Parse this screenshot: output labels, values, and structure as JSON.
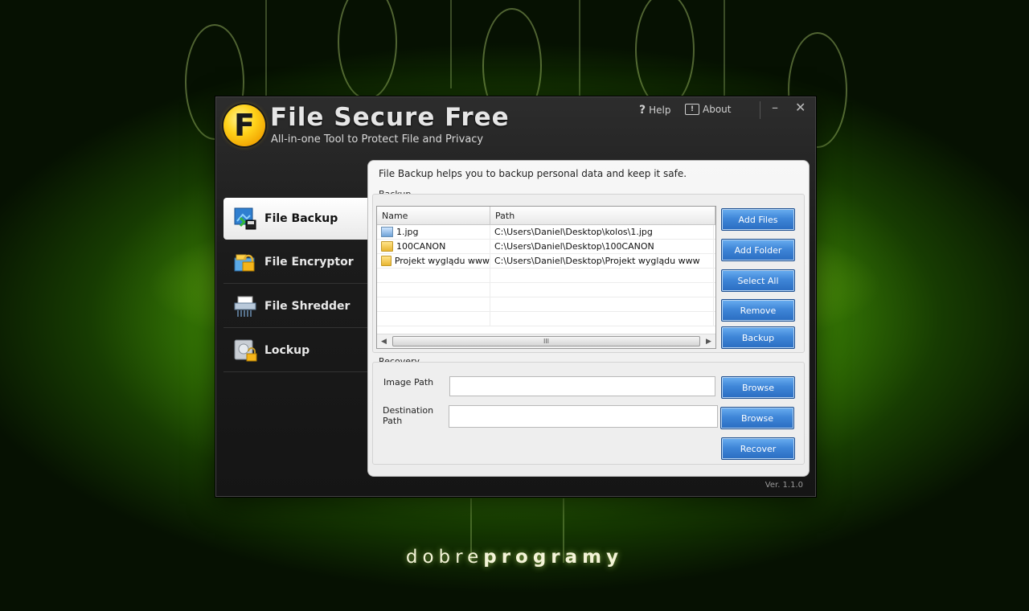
{
  "app": {
    "title": "File Secure Free",
    "subtitle": "All-in-one Tool to Protect File and Privacy",
    "logo_letter": "F",
    "version": "Ver. 1.1.0"
  },
  "top_links": {
    "help": "Help",
    "about": "About"
  },
  "window_controls": {
    "minimize": "–",
    "close": "✕"
  },
  "nav": {
    "items": [
      {
        "label": "File Backup",
        "icon": "backup-icon",
        "active": true
      },
      {
        "label": "File Encryptor",
        "icon": "encryptor-icon",
        "active": false
      },
      {
        "label": "File Shredder",
        "icon": "shredder-icon",
        "active": false
      },
      {
        "label": "Lockup",
        "icon": "lockup-icon",
        "active": false
      }
    ]
  },
  "panel": {
    "intro": "File Backup helps you to backup personal data and keep it safe.",
    "backup": {
      "label": "Backup",
      "columns": [
        "Name",
        "Path"
      ],
      "rows": [
        {
          "name": "1.jpg",
          "path": "C:\\Users\\Daniel\\Desktop\\kolos\\1.jpg",
          "icon": "image-file-icon"
        },
        {
          "name": "100CANON",
          "path": "C:\\Users\\Daniel\\Desktop\\100CANON",
          "icon": "folder-icon"
        },
        {
          "name": "Projekt wyglądu www",
          "path": "C:\\Users\\Daniel\\Desktop\\Projekt wyglądu www",
          "icon": "folder-icon"
        }
      ],
      "scroll_thumb": "III",
      "buttons": {
        "add_files": "Add Files",
        "add_folder": "Add Folder",
        "select_all": "Select All",
        "remove": "Remove",
        "backup": "Backup"
      }
    },
    "recovery": {
      "label": "Recovery",
      "image_path_label": "Image Path",
      "image_path_value": "",
      "destination_path_label": "Destination Path",
      "destination_path_value": "",
      "browse1": "Browse",
      "browse2": "Browse",
      "recover": "Recover"
    }
  },
  "brand": {
    "part1": "dobre",
    "part2": "programy"
  }
}
